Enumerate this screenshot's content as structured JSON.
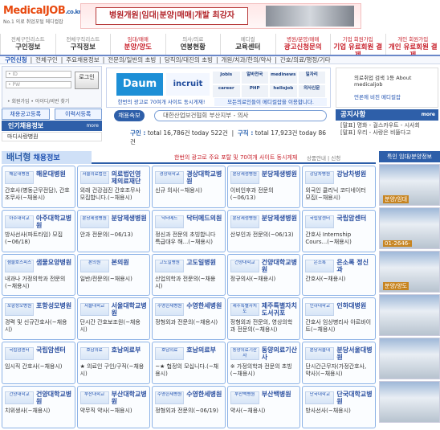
{
  "header": {
    "logo_main": "MedicalJOB",
    "logo_suffix": ".co.kr",
    "logo_tag": "No.1 의료 취업포털 메디컬잡",
    "banner_text": "병원개원|임대|분양|매매|개발 최강자"
  },
  "nav": [
    {
      "sub": "전체구인리스트",
      "main": "구인정보",
      "red": false
    },
    {
      "sub": "전체구직리스트",
      "main": "구직정보",
      "red": false
    },
    {
      "sub": "임대/매매",
      "main": "분양/양도",
      "red": true
    },
    {
      "sub": "의사/의료",
      "main": "연봉현황",
      "red": false
    },
    {
      "sub": "메디컬",
      "main": "교육센터",
      "red": false
    },
    {
      "sub": "병원/분양/매매",
      "main": "광고신청문의",
      "red": true
    },
    {
      "sub": "기업 회원가입",
      "main": "기업 유료회원 결제",
      "red": true
    },
    {
      "sub": "개인 회원가입",
      "main": "개인 유료회원 결제",
      "red": true
    }
  ],
  "subnav": [
    "구인신청",
    "전체구인",
    "주요채용정보",
    "전문의/일반의 초빙",
    "당직의/대진의 초빙",
    "개원/치과/한의/약사",
    "간호/의료/행정/기타"
  ],
  "login": {
    "id_label": "• ID",
    "pw_label": "• PW",
    "button": "로그인",
    "options": "• 회원가입 • 아이디/비번 찾기"
  },
  "ads": {
    "ad1": "Daum",
    "ad2": "incruit",
    "grid": [
      "Jobis",
      "알바천국",
      "medinews",
      "일자리",
      "career",
      "PHP",
      "hellojob",
      "의사신문"
    ],
    "cap1": "한번의 광고로 70여개 사이트 동시게재!",
    "cap2": "모든의료인들이 메디컬잡을 이용합니다."
  },
  "right_ad": {
    "line1": "의료취업 검색 1등 About medicaljob",
    "line2": "언론에 비친 메디컬잡"
  },
  "left": {
    "btn1": "채용공고등록",
    "btn2": "이력서등록",
    "popular": "인기채용정보",
    "popular_more": "more",
    "sub_item": "마디사랑병원"
  },
  "search": {
    "label": "채용속보",
    "text": "대한산업보건협회 부산지부 - 의사"
  },
  "stats": {
    "jobs_label": "구인 :",
    "jobs_total": "total 16,786건",
    "jobs_today": "today 522건",
    "seek_label": "구직 :",
    "seek_total": "total 17,923건",
    "seek_today": "today 86건"
  },
  "notice": {
    "title": "공지사항",
    "more": "more",
    "items": [
      "[말표] 명화 - 걸스카우트 - 시사회",
      "[말표] 우리 - 사랑은 비뚤다고"
    ]
  },
  "banner_bar": {
    "title_b": "배너형",
    "title_r": " 채용정보",
    "mid": "한번의 광고로 주요 포탈 및 70여개 사이트 동시게재",
    "right": "상품안내 | 신청"
  },
  "right_col": {
    "header": "특인 임대/분양정보",
    "imgs": [
      "분양/임대",
      "01-2646-",
      "분양/양도",
      "",
      "",
      ""
    ]
  },
  "cards": [
    {
      "logo": "해운대병원",
      "name": "해운대병원",
      "desc": "간호사(병동근무전담), 간호조무사(~채용시)"
    },
    {
      "logo": "서울의료법인",
      "name": "의료법인영 제의료재단",
      "desc": "외래 건강검진 간호조무사 모집합니다.(~채용시)"
    },
    {
      "logo": "경상대학교",
      "name": "경상대학교병원",
      "desc": "신규 의사(~채용시)"
    },
    {
      "logo": "분당제생병원",
      "name": "분당제생병원",
      "desc": "이비인후과 전문의(~06/13)"
    },
    {
      "logo": "강남차병원",
      "name": "강남차병원",
      "desc": "외국인 클리닉 코디네이터 모집(~채용시)"
    },
    {
      "logo": "아주대학교",
      "name": "아주대학교병원",
      "desc": "방사선사(파트타임) 모집(~06/18)"
    },
    {
      "logo": "분당제생병원",
      "name": "분당제생병원",
      "desc": "안과 전문의(~06/13)"
    },
    {
      "logo": "닥터메드",
      "name": "닥터메드의원",
      "desc": "정신과 전문의 초빙합니다 특급대우 해...(~채용시)"
    },
    {
      "logo": "분당제생병원",
      "name": "분당제생병원",
      "desc": "산부인과 전문의(~06/13)"
    },
    {
      "logo": "국립암센터",
      "name": "국립암센터",
      "desc": "간호사 Internship Cours...(~채용시)"
    },
    {
      "logo": "샘물호스피스",
      "name": "샘물요양병원",
      "desc": "내과나 가정의학과 전문의(~채용시)"
    },
    {
      "logo": "본의원",
      "name": "본의원",
      "desc": "일반/전문의(~채용시)"
    },
    {
      "logo": "고도일병원",
      "name": "고도일병원",
      "desc": "산업의학과 전문의(~채용시)"
    },
    {
      "logo": "건양대학교",
      "name": "건양대학교병원",
      "desc": "정규의사(~채용시)"
    },
    {
      "logo": "은소록",
      "name": "은소록 정신과",
      "desc": "간호사(~채용시)"
    },
    {
      "logo": "포항성모병원",
      "name": "포항성모병원",
      "desc": "경력 및 신규간호사(~채용시)"
    },
    {
      "logo": "서울대학교",
      "name": "서울대학교병원",
      "desc": "단시간 간호보조원(~채용시)"
    },
    {
      "logo": "수영한세병원",
      "name": "수영한세병원",
      "desc": "정형외과 전문의(~채용시)"
    },
    {
      "logo": "제주특별자치도",
      "name": "제주특별자치도서귀포",
      "desc": "정형외과 전문의, 영상의학과 전문의(~채용시)"
    },
    {
      "logo": "인하대학교",
      "name": "인하대병원",
      "desc": "간호사 임상병리사 아르바이트(~채용시)"
    },
    {
      "logo": "국립암센터",
      "name": "국립암센터",
      "desc": "임시직 간호사(~채용시)"
    },
    {
      "logo": "호남의료",
      "name": "호남의료부",
      "desc": "★ 의료인 구인/구직(~채용시)"
    },
    {
      "logo": "호남의료",
      "name": "호남의료부",
      "desc": "~★ 협정의 모십니다.(~채용시)"
    },
    {
      "logo": "동양의료기산사",
      "name": "동양의료기산사",
      "desc": "※ 가정의학과 전문의 초빙(~채용시)"
    },
    {
      "logo": "분당서울대",
      "name": "분당서울대병원",
      "desc": "단시간근무자(가정간호사, 약사)(~채용시)"
    },
    {
      "logo": "건양대학교",
      "name": "건양대학교병원",
      "desc": "치위생사(~채용시)"
    },
    {
      "logo": "부산대학교",
      "name": "부산대학교병원",
      "desc": "약무직 약사(~채용시)"
    },
    {
      "logo": "수영한세병원",
      "name": "수영한세병원",
      "desc": "정형외과 전문의(~06/19)"
    },
    {
      "logo": "부산백병원",
      "name": "부산백병원",
      "desc": "약사(~채용시)"
    },
    {
      "logo": "단국대학교",
      "name": "단국대학교병원",
      "desc": "방사선사(~채용시)"
    }
  ]
}
